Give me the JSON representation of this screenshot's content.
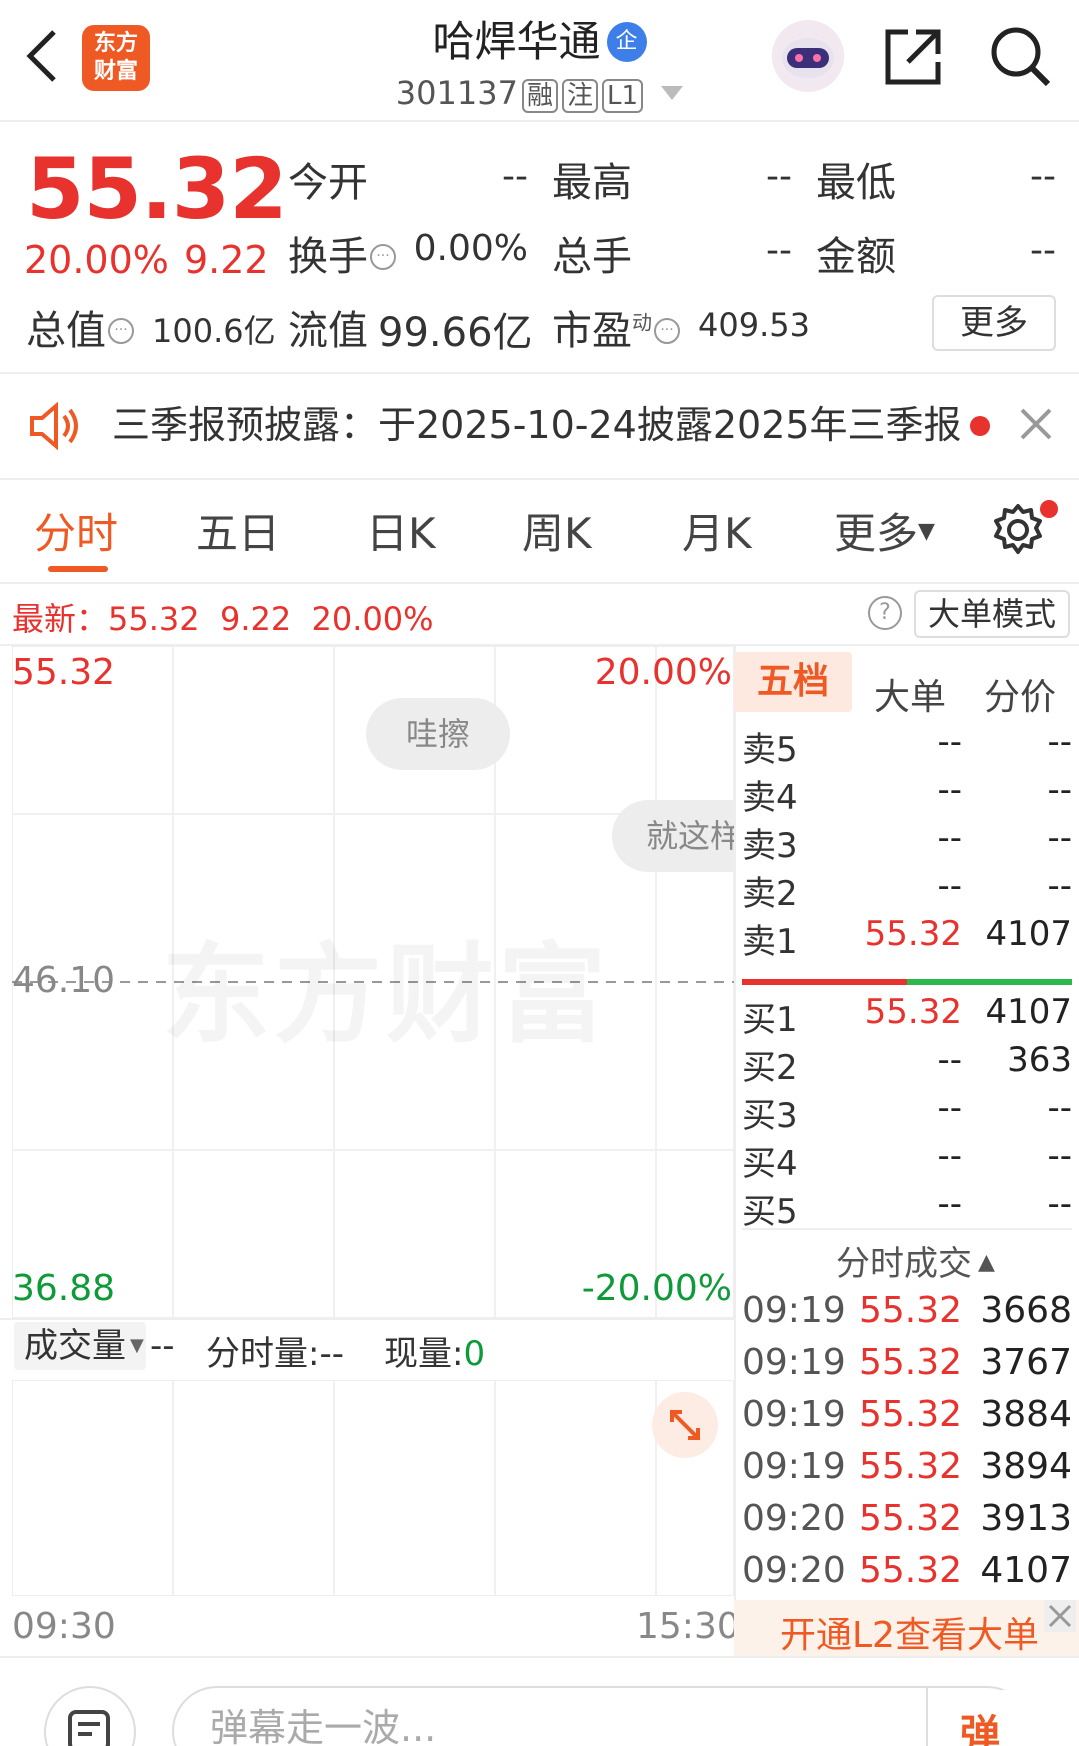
{
  "header": {
    "back_icon": "chevron-left-icon",
    "logo_line1": "东方",
    "logo_line2": "财富",
    "stock_name": "哈焊华通",
    "enterprise_badge": "企",
    "stock_code": "301137",
    "tags": [
      "融",
      "注",
      "L1"
    ],
    "share_icon": "share-icon",
    "search_icon": "search-icon",
    "robot_icon": "assistant-robot-icon"
  },
  "quote": {
    "price": "55.32",
    "change_pct": "20.00%",
    "change": "9.22",
    "open_label": "今开",
    "open_value": "--",
    "high_label": "最高",
    "high_value": "--",
    "low_label": "最低",
    "low_value": "--",
    "turnover_label": "换手",
    "turnover_value": "0.00%",
    "volume_label": "总手",
    "volume_value": "--",
    "amount_label": "金额",
    "amount_value": "--",
    "mktcap_label": "总值",
    "mktcap_value": "100.6亿",
    "float_label": "流值",
    "float_value": "99.66亿",
    "pe_label": "市盈",
    "pe_sup": "动",
    "pe_value": "409.53",
    "more_label": "更多"
  },
  "notice": {
    "text": "三季报预披露：于2025-10-24披露2025年三季报",
    "close": "×"
  },
  "tabs": [
    "分时",
    "五日",
    "日K",
    "周K",
    "月K",
    "更多"
  ],
  "latest_bar": {
    "text": "最新：55.32  9.22  20.00%",
    "help": "?",
    "mode_label": "大单模式"
  },
  "chart": {
    "top_price": "55.32",
    "top_pct": "20.00%",
    "mid_price": "46.10",
    "bottom_price": "36.88",
    "bottom_pct": "-20.00%",
    "watermark": "东方财富",
    "bubble1": "哇擦",
    "bubble2": "就这样",
    "time_start": "09:30",
    "time_end": "15:30"
  },
  "volume": {
    "dropdown": "成交量",
    "dash": "--",
    "minute_vol_label": "分时量:--",
    "current_vol_label": "现量:",
    "current_vol_value": "0"
  },
  "orderbook": {
    "tabs": [
      "五档",
      "大单",
      "分价"
    ],
    "sells": [
      {
        "name": "卖5",
        "price": "--",
        "vol": "--"
      },
      {
        "name": "卖4",
        "price": "--",
        "vol": "--"
      },
      {
        "name": "卖3",
        "price": "--",
        "vol": "--"
      },
      {
        "name": "卖2",
        "price": "--",
        "vol": "--"
      },
      {
        "name": "卖1",
        "price": "55.32",
        "vol": "4107"
      }
    ],
    "buys": [
      {
        "name": "买1",
        "price": "55.32",
        "vol": "4107"
      },
      {
        "name": "买2",
        "price": "--",
        "vol": "363"
      },
      {
        "name": "买3",
        "price": "--",
        "vol": "--"
      },
      {
        "name": "买4",
        "price": "--",
        "vol": "--"
      },
      {
        "name": "买5",
        "price": "--",
        "vol": "--"
      }
    ],
    "ticks_title": "分时成交",
    "ticks": [
      {
        "time": "09:19",
        "price": "55.32",
        "vol": "3668"
      },
      {
        "time": "09:19",
        "price": "55.32",
        "vol": "3767"
      },
      {
        "time": "09:19",
        "price": "55.32",
        "vol": "3884"
      },
      {
        "time": "09:19",
        "price": "55.32",
        "vol": "3894"
      },
      {
        "time": "09:20",
        "price": "55.32",
        "vol": "3913"
      },
      {
        "time": "09:20",
        "price": "55.32",
        "vol": "4107"
      }
    ],
    "l2_text": "开通L2查看大单"
  },
  "bottom": {
    "danmu_placeholder": "弹幕走一波...",
    "danmu_button": "弹"
  },
  "colors": {
    "up": "#e8322d",
    "down": "#0f9a3a",
    "accent": "#ef5a24"
  }
}
